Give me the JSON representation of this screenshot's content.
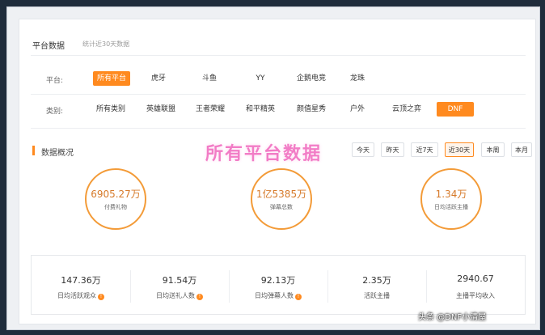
{
  "header": {
    "title": "平台数据",
    "subtitle": "统计近30天数据"
  },
  "filters": {
    "platform_label": "平台:",
    "platforms": [
      "所有平台",
      "虎牙",
      "斗鱼",
      "YY",
      "企鹅电竞",
      "龙珠"
    ],
    "category_label": "类别:",
    "categories": [
      "所有类别",
      "英雄联盟",
      "王者荣耀",
      "和平精英",
      "颜值星秀",
      "户外",
      "云顶之弈",
      "DNF"
    ]
  },
  "overview": {
    "title": "数据概况",
    "watermark": "所有平台数据",
    "periods": [
      "今天",
      "昨天",
      "近7天",
      "近30天",
      "本周",
      "本月"
    ]
  },
  "circles": [
    {
      "value": "6905.27万",
      "caption": "付费礼物"
    },
    {
      "value": "1亿5385万",
      "caption": "弹幕总数"
    },
    {
      "value": "1.34万",
      "caption": "日均活跃主播"
    }
  ],
  "stats": [
    {
      "value": "147.36万",
      "caption": "日均活跃观众",
      "info": true
    },
    {
      "value": "91.54万",
      "caption": "日均送礼人数",
      "info": true
    },
    {
      "value": "92.13万",
      "caption": "日均弹幕人数",
      "info": true
    },
    {
      "value": "2.35万",
      "caption": "活跃主播",
      "info": false
    },
    {
      "value": "2940.67",
      "caption": "主播平均收入",
      "info": false
    }
  ],
  "info_glyph": "!",
  "credit": "头条 @DNF小清屋",
  "colors": {
    "accent": "#ff8a1f",
    "circle": "#f39b38",
    "watermark": "#f27cc6"
  }
}
